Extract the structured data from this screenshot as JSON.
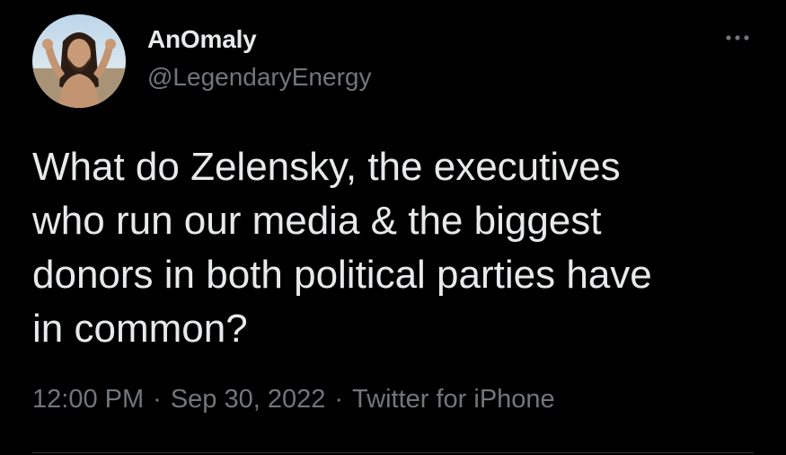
{
  "tweet": {
    "display_name": "AnOmaly",
    "handle": "@LegendaryEnergy",
    "text": "What do Zelensky, the executives\nwho run our media & the biggest\ndonors in both political parties have\nin common?",
    "time": "12:00 PM",
    "separator": "·",
    "date": "Sep 30, 2022",
    "source": "Twitter for iPhone",
    "more_icon": "more-horizontal-icon",
    "avatar_icon": "avatar-photo"
  },
  "colors": {
    "background": "#000000",
    "primary_text": "#e7e9ea",
    "secondary_text": "#71767b",
    "divider": "#2f3336"
  }
}
